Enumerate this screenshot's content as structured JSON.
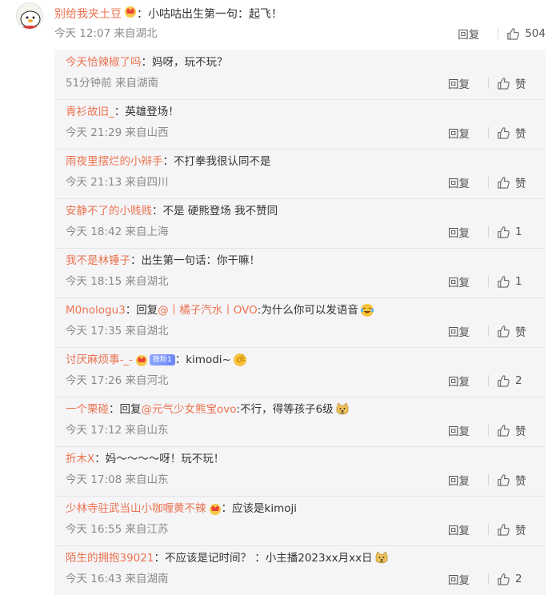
{
  "main_comment": {
    "username": "别给我夹土豆",
    "content": "：小咕咕出生第一句：起飞！",
    "time": "今天 12:07",
    "location": "来自湖北",
    "reply_label": "回复",
    "likes": "504"
  },
  "replies": [
    {
      "username": "今天恰辣椒了吗",
      "pre": "：",
      "content": "妈呀，玩不玩？",
      "time": "51分钟前",
      "location": "来自湖南",
      "reply_label": "回复",
      "likes": "赞"
    },
    {
      "username": "青衫故旧_",
      "pre": "：",
      "content": "英雄登场！",
      "time": "今天 21:29",
      "location": "来自山西",
      "reply_label": "回复",
      "likes": "赞"
    },
    {
      "username": "雨夜里摆烂的小辩手",
      "pre": "：",
      "content": "不打拳我很认同不是",
      "time": "今天 21:13",
      "location": "来自四川",
      "reply_label": "回复",
      "likes": "赞"
    },
    {
      "username": "安静不了的小贱贱",
      "pre": "：",
      "content": "不是 硬熊登场 我不赞同",
      "time": "今天 18:42",
      "location": "来自上海",
      "reply_label": "回复",
      "likes": "1"
    },
    {
      "username": "我不是林锤子",
      "pre": "：",
      "content": "出生第一句话：你干嘛！",
      "time": "今天 18:15",
      "location": "来自湖北",
      "reply_label": "回复",
      "likes": "1"
    },
    {
      "username": "M0nologu3",
      "pre": "：回复",
      "mention": "@丨橘子汽水丨OVO",
      "content": ":为什么你可以发语音",
      "emoji": "laugh-cry",
      "time": "今天 17:35",
      "location": "来自湖北",
      "reply_label": "回复",
      "likes": "赞"
    },
    {
      "username": "讨厌麻烦事-_-",
      "vip": true,
      "badge": "铁粉1",
      "pre": "：",
      "content": "kimodi~",
      "emoji": "ok-hand",
      "time": "今天 17:26",
      "location": "来自河北",
      "reply_label": "回复",
      "likes": "2"
    },
    {
      "username": "一个栗碰",
      "pre": "：回复",
      "mention": "@元气少女熊宝ovo",
      "content": ":不行，得等孩子6级",
      "emoji": "doge",
      "time": "今天 17:12",
      "location": "来自山东",
      "reply_label": "回复",
      "likes": "赞"
    },
    {
      "username": "折木X",
      "pre": "：",
      "content": "妈～～～～呀！玩不玩！",
      "time": "今天 17:08",
      "location": "来自山东",
      "reply_label": "回复",
      "likes": "赞"
    },
    {
      "username": "少林寺驻武当山小咖喱黄不辣",
      "vip": true,
      "pre": "：",
      "content": "应该是kimoji",
      "time": "今天 16:55",
      "location": "来自江苏",
      "reply_label": "回复",
      "likes": "赞"
    },
    {
      "username": "陌生的拥抱39021",
      "pre": "：",
      "content": "不应该是记时间？ ：小主播2023xx月xx日",
      "emoji": "doge",
      "time": "今天 16:43",
      "location": "来自湖南",
      "reply_label": "回复",
      "likes": "2"
    }
  ]
}
